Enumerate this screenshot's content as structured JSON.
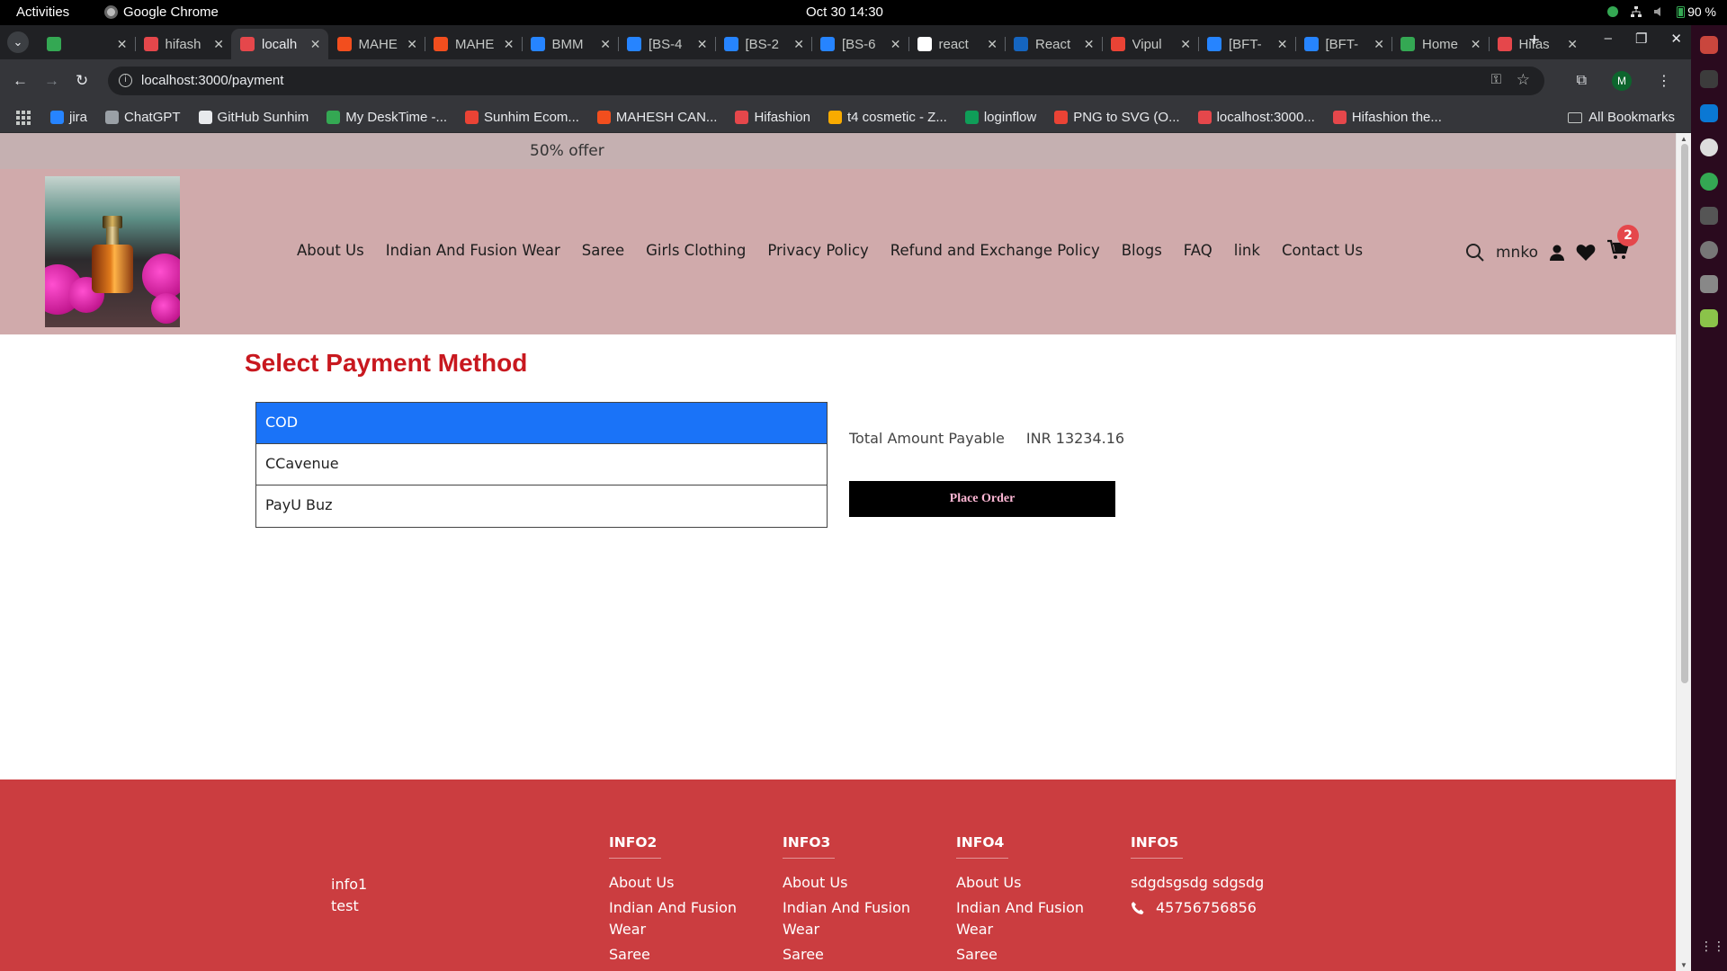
{
  "system_bar": {
    "activities": "Activities",
    "app_name": "Google Chrome",
    "datetime": "Oct 30  14:30",
    "battery": "90 %"
  },
  "browser": {
    "tabs": [
      {
        "title": "",
        "color": "#34a853"
      },
      {
        "title": "hifash",
        "color": "#e5474b"
      },
      {
        "title": "localh",
        "color": "#e5474b",
        "active": true
      },
      {
        "title": "MAHE",
        "color": "#f24e1e"
      },
      {
        "title": "MAHE",
        "color": "#f24e1e"
      },
      {
        "title": "BMM",
        "color": "#2684ff"
      },
      {
        "title": "[BS-4",
        "color": "#2684ff"
      },
      {
        "title": "[BS-2",
        "color": "#2684ff"
      },
      {
        "title": "[BS-6",
        "color": "#2684ff"
      },
      {
        "title": "react",
        "color": "#ffffff"
      },
      {
        "title": "React",
        "color": "#1565c0"
      },
      {
        "title": "Vipul",
        "color": "#ea4335"
      },
      {
        "title": "[BFT-",
        "color": "#2684ff"
      },
      {
        "title": "[BFT-",
        "color": "#2684ff"
      },
      {
        "title": "Home",
        "color": "#34a853"
      },
      {
        "title": "Hifas",
        "color": "#e5474b"
      }
    ],
    "url": "localhost:3000/payment",
    "bookmarks": [
      {
        "label": "jira",
        "color": "#2684ff"
      },
      {
        "label": "ChatGPT",
        "color": "#9aa0a6"
      },
      {
        "label": "GitHub Sunhim",
        "color": "#e8eaed"
      },
      {
        "label": "My DeskTime -...",
        "color": "#34a853"
      },
      {
        "label": "Sunhim Ecom...",
        "color": "#ea4335"
      },
      {
        "label": "MAHESH CAN...",
        "color": "#f24e1e"
      },
      {
        "label": "Hifashion",
        "color": "#e5474b"
      },
      {
        "label": "t4 cosmetic - Z...",
        "color": "#f9ab00"
      },
      {
        "label": "loginflow",
        "color": "#0f9d58"
      },
      {
        "label": "PNG to SVG (O...",
        "color": "#ea4335"
      },
      {
        "label": "localhost:3000...",
        "color": "#e5474b"
      },
      {
        "label": "Hifashion the...",
        "color": "#e5474b"
      }
    ],
    "all_bookmarks": "All Bookmarks",
    "profile_initial": "M"
  },
  "page": {
    "offer": "50% offer",
    "nav": [
      "About Us",
      "Indian And Fusion Wear",
      "Saree",
      "Girls Clothing",
      "Privacy Policy",
      "Refund and Exchange Policy",
      "Blogs",
      "FAQ",
      "link",
      "Contact Us"
    ],
    "username": "mnko",
    "cart_count": "2",
    "payment": {
      "title": "Select Payment Method",
      "methods": [
        "COD",
        "CCavenue",
        "PayU Buz"
      ],
      "selected": "COD",
      "total_label": "Total Amount Payable",
      "total_value": "INR 13234.16",
      "place_order": "Place Order"
    },
    "footer": {
      "info1": {
        "title": "info1",
        "text": "test"
      },
      "columns": [
        {
          "title": "INFO2",
          "items": [
            "About Us",
            "Indian And Fusion Wear",
            "Saree"
          ]
        },
        {
          "title": "INFO3",
          "items": [
            "About Us",
            "Indian And Fusion Wear",
            "Saree"
          ]
        },
        {
          "title": "INFO4",
          "items": [
            "About Us",
            "Indian And Fusion Wear",
            "Saree"
          ]
        }
      ],
      "info5": {
        "title": "INFO5",
        "text": "sdgdsgsdg sdgsdg",
        "phone": "45756756856"
      }
    }
  }
}
